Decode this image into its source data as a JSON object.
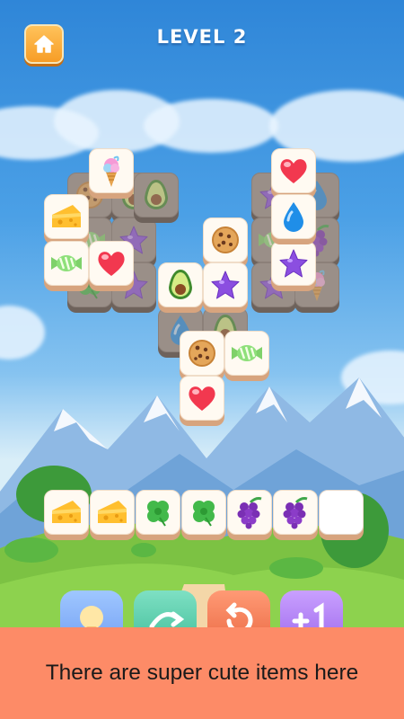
{
  "header": {
    "level_label": "LEVEL 2"
  },
  "board_tiles": [
    "icecream",
    "cookie",
    "avocado",
    "cheese",
    "candy",
    "heart",
    "star",
    "star",
    "candy",
    "clover",
    "cheese",
    "avocado",
    "star",
    "heart",
    "drop",
    "star",
    "cookie",
    "candy",
    "drop",
    "grapes",
    "star",
    "star",
    "icecream",
    "avocado",
    "drop",
    "avocado",
    "cookie",
    "candy",
    "heart"
  ],
  "tray": {
    "slots": [
      "cheese",
      "cheese",
      "clover",
      "clover",
      "grapes",
      "grapes",
      ""
    ],
    "capacity": 7
  },
  "boosters": [
    "hint",
    "shuffle",
    "undo",
    "plus-one"
  ],
  "banner": {
    "text": "There are super cute items here"
  }
}
